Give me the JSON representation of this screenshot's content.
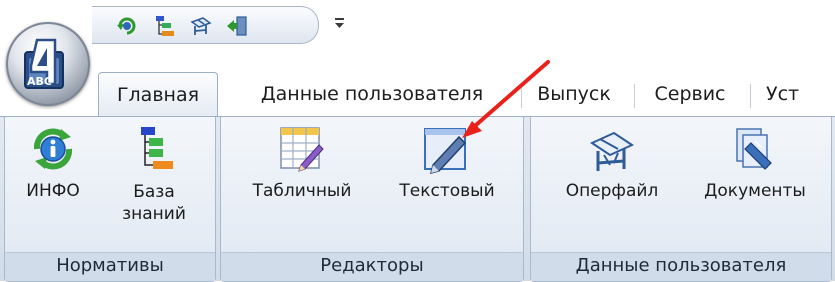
{
  "app_orb": {
    "logo_text": "ABC",
    "logo_number": "4"
  },
  "quick_access": {
    "items": [
      {
        "icon": "refresh-icon"
      },
      {
        "icon": "structure-icon"
      },
      {
        "icon": "workbench-icon"
      },
      {
        "icon": "exit-icon"
      }
    ],
    "menu_glyph": "▾"
  },
  "tabs": [
    {
      "label": "Главная",
      "active": true
    },
    {
      "label": "Данные пользователя",
      "active": false
    },
    {
      "label": "Выпуск",
      "active": false
    },
    {
      "label": "Сервис",
      "active": false
    },
    {
      "label": "Уст",
      "active": false
    }
  ],
  "groups": {
    "normatives": {
      "title": "Нормативы",
      "buttons": [
        {
          "label": "ИНФО",
          "icon": "info-icon"
        },
        {
          "label": "База\nзнаний",
          "icon": "knowledge-base-icon"
        }
      ]
    },
    "editors": {
      "title": "Редакторы",
      "buttons": [
        {
          "label": "Табличный",
          "icon": "table-editor-icon"
        },
        {
          "label": "Текстовый",
          "icon": "text-editor-icon"
        }
      ]
    },
    "user_data": {
      "title": "Данные пользователя",
      "buttons": [
        {
          "label": "Оперфайл",
          "icon": "operfile-icon"
        },
        {
          "label": "Документы",
          "icon": "documents-icon"
        }
      ]
    }
  },
  "annotation": {
    "color": "#e8221b",
    "target": "Текстовый"
  },
  "colors": {
    "ribbon": "#dfe7f1",
    "group_title_bg": "#d1dcea",
    "border": "#a9b8cb"
  }
}
